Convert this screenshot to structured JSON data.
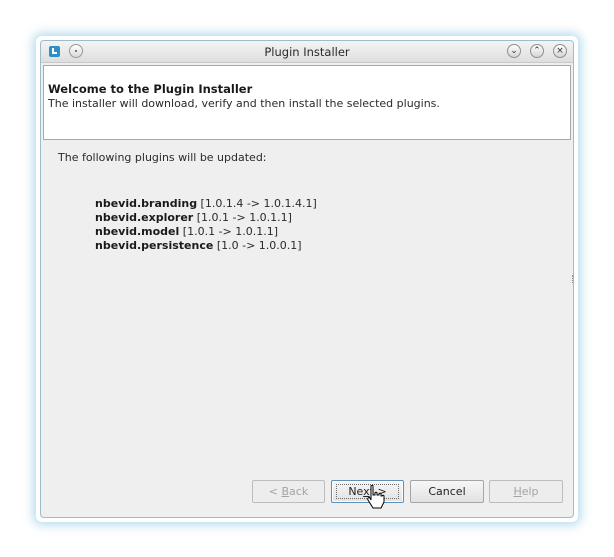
{
  "window": {
    "title": "Plugin Installer",
    "controls": {
      "minimize": "⌄",
      "maximize": "⌃",
      "close": "×"
    }
  },
  "header": {
    "title": "Welcome to the Plugin Installer",
    "description": "The installer will download, verify and then install the selected plugins."
  },
  "intro": "The following plugins will be updated:",
  "plugins": [
    {
      "name": "nbevid.branding",
      "versions": " [1.0.1.4 -> 1.0.1.4.1]"
    },
    {
      "name": "nbevid.explorer",
      "versions": " [1.0.1 -> 1.0.1.1]"
    },
    {
      "name": "nbevid.model",
      "versions": " [1.0.1 -> 1.0.1.1]"
    },
    {
      "name": "nbevid.persistence",
      "versions": " [1.0 -> 1.0.0.1]"
    }
  ],
  "buttons": {
    "back": {
      "prefix": "< ",
      "mnemonic": "B",
      "rest": "ack",
      "enabled": false
    },
    "next": {
      "prefix": "Ne",
      "mnemonic": "x",
      "rest": "t >",
      "enabled": true
    },
    "cancel": {
      "label": "Cancel",
      "enabled": true
    },
    "help": {
      "prefix": "",
      "mnemonic": "H",
      "rest": "elp",
      "enabled": false
    }
  },
  "colors": {
    "dialog_bg": "#efefef",
    "header_bg": "#ffffff",
    "focus_border": "#5d8fb8",
    "window_glow": "#78bedc"
  },
  "icons": [
    "app-icon",
    "pin-icon",
    "minimize-icon",
    "maximize-icon",
    "close-icon",
    "pointer-cursor-icon"
  ]
}
